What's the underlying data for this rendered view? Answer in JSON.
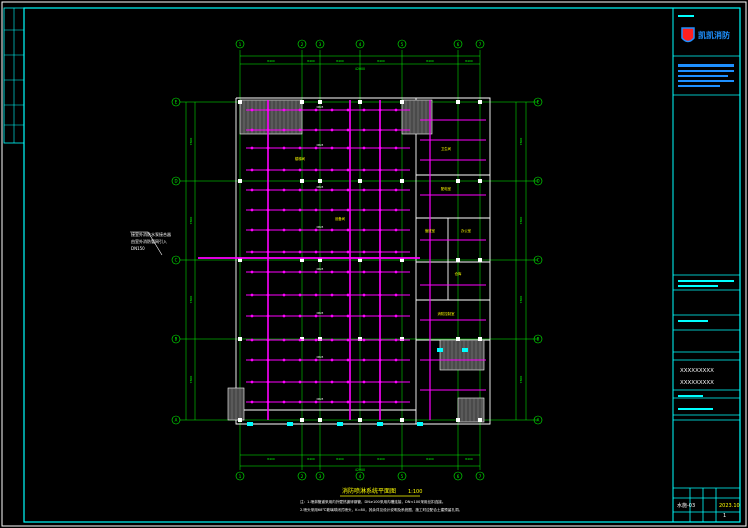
{
  "drawing": {
    "title": "消防喷淋系统平面图",
    "scale": "1:100",
    "notes": [
      "注：1.喷淋管道采用内外壁热镀锌钢管，DN≥100采用沟槽连接，DN<100采用丝扣连接。",
      "2.喷头采用68℃玻璃球闭式喷头，K=80，其余详见设计说明及系统图，施工时应配合土建预留孔洞。"
    ],
    "callout": [
      "接室外消防水泵接合器",
      "由室外消防管网引入",
      "DN150"
    ],
    "grid_cols": [
      "1",
      "2",
      "3",
      "4",
      "5",
      "6"
    ],
    "grid_rows": [
      "E",
      "D",
      "C",
      "B",
      "A"
    ],
    "dims_top": [
      "8400",
      "8400",
      "8400",
      "8400",
      "8400",
      "8400"
    ],
    "dims_top_total": "42000",
    "dims_bottom": [
      "8400",
      "8400",
      "8400",
      "8400",
      "8400",
      "8400"
    ],
    "dims_bottom_total": "42000",
    "dims_side": [
      "7800",
      "7800",
      "7800",
      "7800"
    ],
    "dims_side_total": "31200",
    "room_labels": [
      "配电室",
      "办公室",
      "值班室",
      "仓库",
      "消防控制室",
      "卫生间",
      "楼梯间",
      "设备间"
    ]
  },
  "title_block": {
    "company": "凯凯消防",
    "project_lines": [
      "XXXXXXXXX",
      "XXXXXXXXX"
    ],
    "drawing_no": "水施-03",
    "date": "2023.10",
    "sheet": "1"
  },
  "colors": {
    "background": "#000000",
    "frame": "#00ffff",
    "axis": "#00ff00",
    "pipe": "#ff00ff",
    "wall": "#ffffff",
    "text": "#ffff00",
    "logo": "#1e90ff",
    "logo_red": "#ff2020"
  }
}
